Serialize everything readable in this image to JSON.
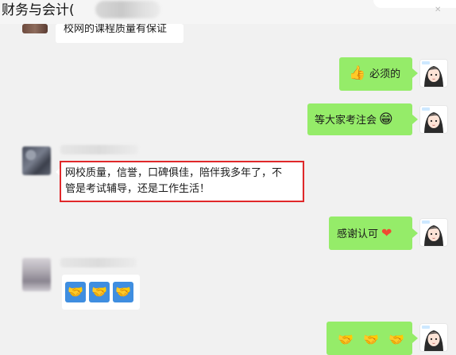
{
  "header": {
    "title": "财务与会计("
  },
  "messages": {
    "top_partial": "校网的课程质量有保证",
    "self_1": "必须的",
    "self_2": "等大家考注会",
    "other_highlight_line1": "网校质量，信誉，口碑俱佳，陪伴我多年了，不",
    "other_highlight_line2": "管是考试辅导，还是工作生活！",
    "self_3": "感谢认可"
  },
  "icons": {
    "thumbs_up": "👍",
    "grin": "😁",
    "heart": "❤",
    "handshake": "🤝"
  },
  "colors": {
    "self_bubble": "#95ec69",
    "other_bubble": "#ffffff",
    "highlight": "#e0282a",
    "background": "#f1f1f1"
  }
}
